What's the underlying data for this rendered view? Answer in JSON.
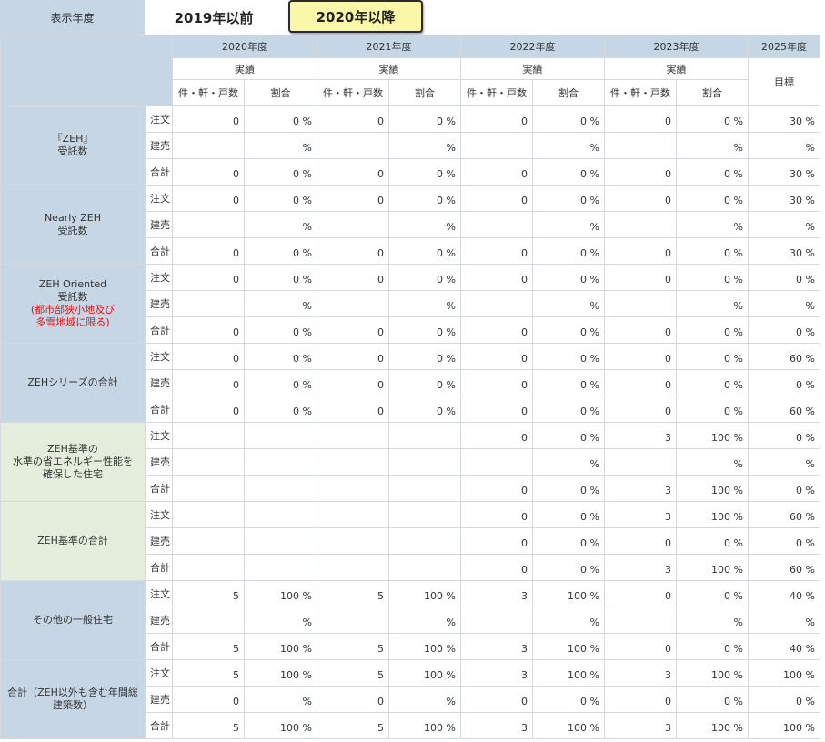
{
  "topbar": {
    "label": "表示年度",
    "btn_2019": "2019年以前",
    "btn_2020": "2020年以降"
  },
  "header": {
    "years": [
      "2020年度",
      "2021年度",
      "2022年度",
      "2023年度"
    ],
    "target_year": "2025年度",
    "actual_label": "実績",
    "target_label": "目標",
    "col_count": "件・軒・戸数",
    "col_ratio": "割合"
  },
  "rows": [
    {
      "cat": [
        "『ZEH』",
        "受託数"
      ],
      "note": [],
      "green": false,
      "sub": [
        {
          "label": "注文",
          "v": [
            [
              "0",
              "0 %"
            ],
            [
              "0",
              "0 %"
            ],
            [
              "0",
              "0 %"
            ],
            [
              "0",
              "0 %"
            ]
          ],
          "t": "30 %"
        },
        {
          "label": "建売",
          "v": [
            [
              "",
              "%"
            ],
            [
              "",
              "%"
            ],
            [
              "",
              "%"
            ],
            [
              "",
              "%"
            ]
          ],
          "t": "%"
        },
        {
          "label": "合計",
          "v": [
            [
              "0",
              "0 %"
            ],
            [
              "0",
              "0 %"
            ],
            [
              "0",
              "0 %"
            ],
            [
              "0",
              "0 %"
            ]
          ],
          "t": "30 %"
        }
      ]
    },
    {
      "cat": [
        "Nearly ZEH",
        "受託数"
      ],
      "note": [],
      "green": false,
      "sub": [
        {
          "label": "注文",
          "v": [
            [
              "0",
              "0 %"
            ],
            [
              "0",
              "0 %"
            ],
            [
              "0",
              "0 %"
            ],
            [
              "0",
              "0 %"
            ]
          ],
          "t": "30 %"
        },
        {
          "label": "建売",
          "v": [
            [
              "",
              "%"
            ],
            [
              "",
              "%"
            ],
            [
              "",
              "%"
            ],
            [
              "",
              "%"
            ]
          ],
          "t": "%"
        },
        {
          "label": "合計",
          "v": [
            [
              "0",
              "0 %"
            ],
            [
              "0",
              "0 %"
            ],
            [
              "0",
              "0 %"
            ],
            [
              "0",
              "0 %"
            ]
          ],
          "t": "30 %"
        }
      ]
    },
    {
      "cat": [
        "ZEH Oriented",
        "受託数"
      ],
      "note": [
        "(都市部狭小地及び",
        "多雪地域に限る)"
      ],
      "green": false,
      "sub": [
        {
          "label": "注文",
          "v": [
            [
              "0",
              "0 %"
            ],
            [
              "0",
              "0 %"
            ],
            [
              "0",
              "0 %"
            ],
            [
              "0",
              "0 %"
            ]
          ],
          "t": "0 %"
        },
        {
          "label": "建売",
          "v": [
            [
              "",
              "%"
            ],
            [
              "",
              "%"
            ],
            [
              "",
              "%"
            ],
            [
              "",
              "%"
            ]
          ],
          "t": "%"
        },
        {
          "label": "合計",
          "v": [
            [
              "0",
              "0 %"
            ],
            [
              "0",
              "0 %"
            ],
            [
              "0",
              "0 %"
            ],
            [
              "0",
              "0 %"
            ]
          ],
          "t": "0 %"
        }
      ]
    },
    {
      "cat": [
        "ZEHシリーズの合計"
      ],
      "note": [],
      "green": false,
      "sub": [
        {
          "label": "注文",
          "v": [
            [
              "0",
              "0 %"
            ],
            [
              "0",
              "0 %"
            ],
            [
              "0",
              "0 %"
            ],
            [
              "0",
              "0 %"
            ]
          ],
          "t": "60 %"
        },
        {
          "label": "建売",
          "v": [
            [
              "0",
              "0 %"
            ],
            [
              "0",
              "0 %"
            ],
            [
              "0",
              "0 %"
            ],
            [
              "0",
              "0 %"
            ]
          ],
          "t": "0 %"
        },
        {
          "label": "合計",
          "v": [
            [
              "0",
              "0 %"
            ],
            [
              "0",
              "0 %"
            ],
            [
              "0",
              "0 %"
            ],
            [
              "0",
              "0 %"
            ]
          ],
          "t": "60 %"
        }
      ]
    },
    {
      "cat": [
        "ZEH基準の",
        "水準の省エネルギー性能を",
        "確保した住宅"
      ],
      "note": [],
      "green": true,
      "sub": [
        {
          "label": "注文",
          "v": [
            [
              "",
              ""
            ],
            [
              "",
              ""
            ],
            [
              "0",
              "0 %"
            ],
            [
              "3",
              "100 %"
            ]
          ],
          "t": "0 %"
        },
        {
          "label": "建売",
          "v": [
            [
              "",
              ""
            ],
            [
              "",
              ""
            ],
            [
              "",
              "%"
            ],
            [
              "",
              "%"
            ]
          ],
          "t": "%"
        },
        {
          "label": "合計",
          "v": [
            [
              "",
              ""
            ],
            [
              "",
              ""
            ],
            [
              "0",
              "0 %"
            ],
            [
              "3",
              "100 %"
            ]
          ],
          "t": "0 %"
        }
      ]
    },
    {
      "cat": [
        "ZEH基準の合計"
      ],
      "note": [],
      "green": true,
      "sub": [
        {
          "label": "注文",
          "v": [
            [
              "",
              ""
            ],
            [
              "",
              ""
            ],
            [
              "0",
              "0 %"
            ],
            [
              "3",
              "100 %"
            ]
          ],
          "t": "60 %"
        },
        {
          "label": "建売",
          "v": [
            [
              "",
              ""
            ],
            [
              "",
              ""
            ],
            [
              "0",
              "0 %"
            ],
            [
              "0",
              "0 %"
            ]
          ],
          "t": "0 %"
        },
        {
          "label": "合計",
          "v": [
            [
              "",
              ""
            ],
            [
              "",
              ""
            ],
            [
              "0",
              "0 %"
            ],
            [
              "3",
              "100 %"
            ]
          ],
          "t": "60 %"
        }
      ]
    },
    {
      "cat": [
        "その他の一般住宅"
      ],
      "note": [],
      "green": false,
      "sub": [
        {
          "label": "注文",
          "v": [
            [
              "5",
              "100 %"
            ],
            [
              "5",
              "100 %"
            ],
            [
              "3",
              "100 %"
            ],
            [
              "0",
              "0 %"
            ]
          ],
          "t": "40 %"
        },
        {
          "label": "建売",
          "v": [
            [
              "",
              "%"
            ],
            [
              "",
              "%"
            ],
            [
              "",
              "%"
            ],
            [
              "",
              "%"
            ]
          ],
          "t": "%"
        },
        {
          "label": "合計",
          "v": [
            [
              "5",
              "100 %"
            ],
            [
              "5",
              "100 %"
            ],
            [
              "3",
              "100 %"
            ],
            [
              "0",
              "0 %"
            ]
          ],
          "t": "40 %"
        }
      ]
    },
    {
      "cat": [
        "合計（ZEH以外も含む年間総",
        "建築数）"
      ],
      "note": [],
      "green": false,
      "sub": [
        {
          "label": "注文",
          "v": [
            [
              "5",
              "100 %"
            ],
            [
              "5",
              "100 %"
            ],
            [
              "3",
              "100 %"
            ],
            [
              "3",
              "100 %"
            ]
          ],
          "t": "100 %"
        },
        {
          "label": "建売",
          "v": [
            [
              "0",
              "%"
            ],
            [
              "0",
              "%"
            ],
            [
              "0",
              "0 %"
            ],
            [
              "0",
              "0 %"
            ]
          ],
          "t": "0 %"
        },
        {
          "label": "合計",
          "v": [
            [
              "5",
              "100 %"
            ],
            [
              "5",
              "100 %"
            ],
            [
              "3",
              "100 %"
            ],
            [
              "3",
              "100 %"
            ]
          ],
          "t": "100 %"
        }
      ]
    }
  ]
}
